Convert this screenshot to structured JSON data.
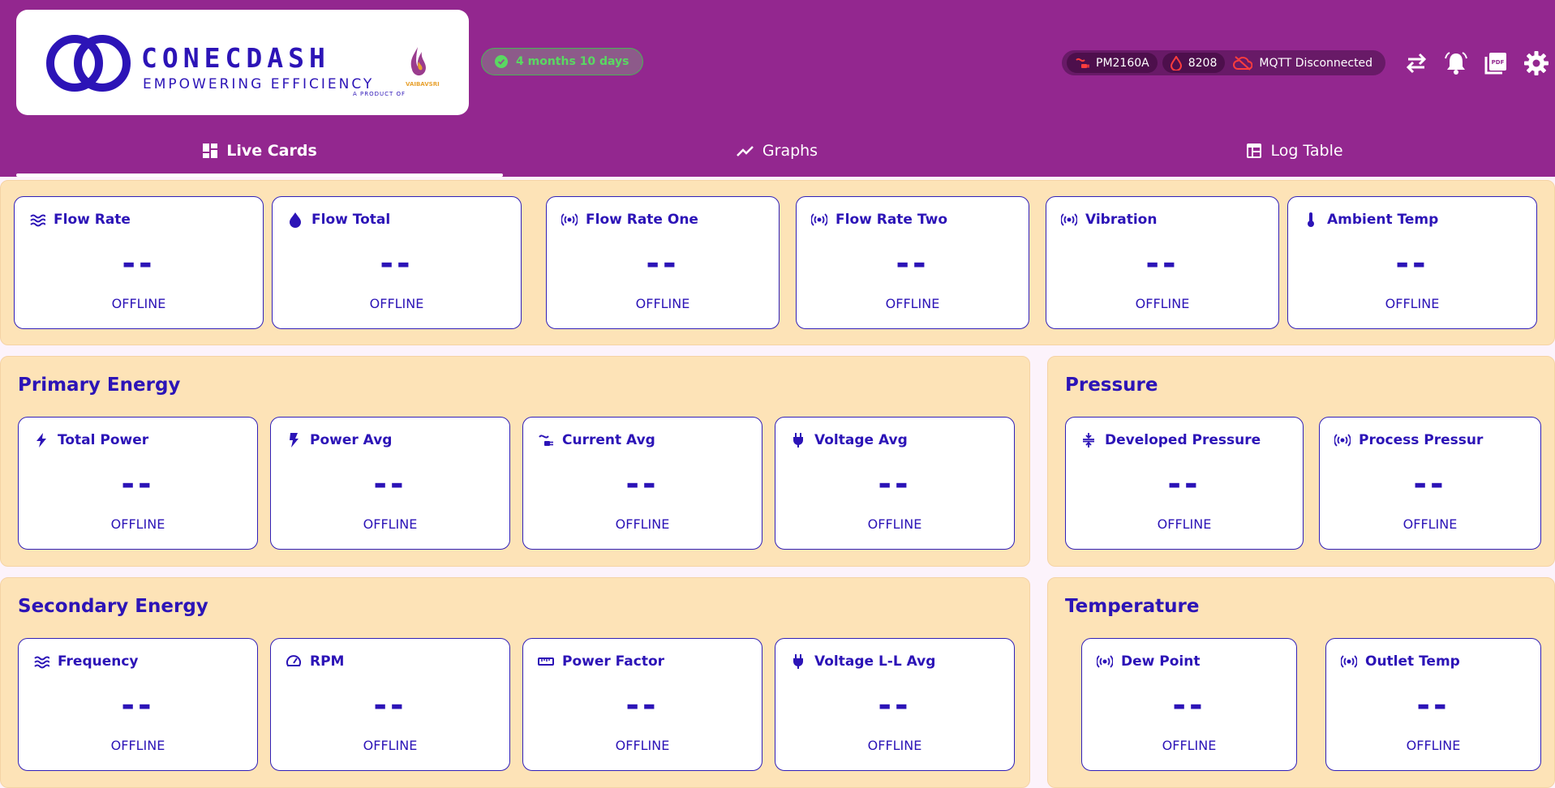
{
  "brand": {
    "name": "CONECDASH",
    "tagline": "EMPOWERING EFFICIENCY",
    "product_of": "A PRODUCT OF",
    "partner": "VAIBAVSRI"
  },
  "license": {
    "text": "4 months 10 days",
    "icon": "check-circle-icon"
  },
  "status": {
    "device": "PM2160A",
    "counter": "8208",
    "mqtt": "MQTT Disconnected"
  },
  "tabs": [
    {
      "label": "Live Cards",
      "icon": "dashboard-icon",
      "active": true
    },
    {
      "label": "Graphs",
      "icon": "trend-icon",
      "active": false
    },
    {
      "label": "Log Table",
      "icon": "table-icon",
      "active": false
    }
  ],
  "top_cards": [
    {
      "label": "Flow Rate",
      "icon": "waves-icon",
      "value": "--",
      "status": "OFFLINE"
    },
    {
      "label": "Flow Total",
      "icon": "water-drop-icon",
      "value": "--",
      "status": "OFFLINE"
    },
    {
      "label": "Flow Rate One",
      "icon": "sensor-icon",
      "value": "--",
      "status": "OFFLINE"
    },
    {
      "label": "Flow Rate Two",
      "icon": "sensor-icon",
      "value": "--",
      "status": "OFFLINE"
    },
    {
      "label": "Vibration",
      "icon": "sensor-icon",
      "value": "--",
      "status": "OFFLINE"
    },
    {
      "label": "Ambient Temp",
      "icon": "thermometer-icon",
      "value": "--",
      "status": "OFFLINE"
    }
  ],
  "primary_energy": {
    "title": "Primary Energy",
    "cards": [
      {
        "label": "Total Power",
        "icon": "bolt-icon",
        "value": "--",
        "status": "OFFLINE"
      },
      {
        "label": "Power Avg",
        "icon": "flash-icon",
        "value": "--",
        "status": "OFFLINE"
      },
      {
        "label": "Current Avg",
        "icon": "current-icon",
        "value": "--",
        "status": "OFFLINE"
      },
      {
        "label": "Voltage Avg",
        "icon": "plug-icon",
        "value": "--",
        "status": "OFFLINE"
      }
    ]
  },
  "pressure": {
    "title": "Pressure",
    "cards": [
      {
        "label": "Developed Pressure",
        "icon": "compress-icon",
        "value": "--",
        "status": "OFFLINE"
      },
      {
        "label": "Process Pressur",
        "icon": "sensor-icon",
        "value": "--",
        "status": "OFFLINE"
      }
    ]
  },
  "secondary_energy": {
    "title": "Secondary Energy",
    "cards": [
      {
        "label": "Frequency",
        "icon": "waves-icon",
        "value": "--",
        "status": "OFFLINE"
      },
      {
        "label": "RPM",
        "icon": "speed-icon",
        "value": "--",
        "status": "OFFLINE"
      },
      {
        "label": "Power Factor",
        "icon": "ruler-icon",
        "value": "--",
        "status": "OFFLINE"
      },
      {
        "label": "Voltage L-L Avg",
        "icon": "plug-icon",
        "value": "--",
        "status": "OFFLINE"
      }
    ]
  },
  "temperature": {
    "title": "Temperature",
    "cards": [
      {
        "label": "Dew Point",
        "icon": "sensor-icon",
        "value": "--",
        "status": "OFFLINE"
      },
      {
        "label": "Outlet Temp",
        "icon": "sensor-icon",
        "value": "--",
        "status": "OFFLINE"
      }
    ]
  },
  "colors": {
    "header": "#93278f",
    "panel": "#fde3b7",
    "accent": "#2c14b7",
    "license_green": "#5ad862",
    "alert_red": "#ff3d3d"
  }
}
